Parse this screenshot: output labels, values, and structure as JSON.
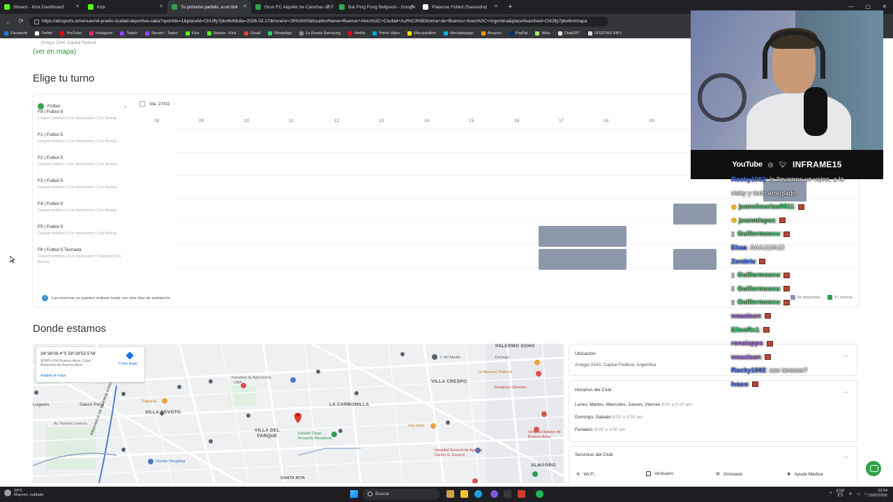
{
  "browser": {
    "tabs": [
      {
        "label": "Stream - Kick Dashboard",
        "color": "#53fc18",
        "glyph": "K"
      },
      {
        "label": "Kick",
        "color": "#53fc18",
        "glyph": "K"
      },
      {
        "label": "Tu próximo partido, a un link",
        "color": "#2fa24b",
        "glyph": "•"
      },
      {
        "label": "Grun FC Alquiler de Canchas de F",
        "color": "#2fa24b",
        "glyph": "•"
      },
      {
        "label": "Bar Ping Pong Belgrano - Google",
        "color": "#34a853",
        "glyph": "•"
      },
      {
        "label": "Platense Fútbol (Saavedra)",
        "color": "#ffffff",
        "glyph": ""
      }
    ],
    "url": "https://atcsports.io/venues/el-predio-ciudad-deportiva-caba?sportIds=1&placeId=ChIJ9y7pkx6v8&dia=2026-02-27&horario=19%3A00&locationName=Buenos+Aires%2C+Ciudad+Aut%C3%B3noma+de+Buenos+Aires%2C+Argentina&placeSearched=ChIJ9y7pkx6v#mapa",
    "bookmarks": [
      {
        "label": "Facebook",
        "color": "#1877f2"
      },
      {
        "label": "Twitter",
        "color": "#ffffff"
      },
      {
        "label": "YouTube",
        "color": "#ff0000"
      },
      {
        "label": "Instagram",
        "color": "#e1306c"
      },
      {
        "label": "Twitch",
        "color": "#9146ff"
      },
      {
        "label": "Stream - Twitch",
        "color": "#9146ff"
      },
      {
        "label": "Kick",
        "color": "#53fc18"
      },
      {
        "label": "Stream - Kick",
        "color": "#53fc18"
      },
      {
        "label": "Gmail",
        "color": "#ea4335"
      },
      {
        "label": "WhatsApp",
        "color": "#25d366"
      },
      {
        "label": "La Ronda Simracing",
        "color": "#888888"
      },
      {
        "label": "Netflix",
        "color": "#e50914"
      },
      {
        "label": "Prime Video",
        "color": "#00a8e1"
      },
      {
        "label": "Mercadolibre",
        "color": "#ffe600"
      },
      {
        "label": "Mercadopago",
        "color": "#00b1ea"
      },
      {
        "label": "Amazon",
        "color": "#ff9900"
      },
      {
        "label": "PayPal",
        "color": "#003087"
      },
      {
        "label": "Wise",
        "color": "#9fe870"
      },
      {
        "label": "ChatGPT",
        "color": "#dddddd"
      },
      {
        "label": "OFERTAS RIKY",
        "color": "#dddddd"
      }
    ]
  },
  "page": {
    "address_line": "Arregui 2540, Capital Federal",
    "ver_mapa": "(ver en mapa)",
    "turno_title": "Elige tu turno",
    "sport": "Fútbol",
    "date": "Vie. 27/02",
    "hours": [
      "08",
      "09",
      "10",
      "11",
      "12",
      "13",
      "14",
      "15",
      "16",
      "17",
      "18",
      "19"
    ],
    "courts": [
      {
        "name": "F8 | Futbol 8",
        "desc": "Césped sintético | Con iluminación | Con Beelup"
      },
      {
        "name": "F1 | Futbol 5",
        "desc": "Césped sintético | Con iluminación | Con Beelup"
      },
      {
        "name": "F2 | Futbol 5",
        "desc": "Césped sintético | Con iluminación | Con Beelup"
      },
      {
        "name": "F3 | Futbol 5",
        "desc": "Césped sintético | Con iluminación | Con Beelup"
      },
      {
        "name": "F4 | Futbol 5",
        "desc": "Césped sintético | Con iluminación | Con Beelup"
      },
      {
        "name": "F5 | Futbol 5",
        "desc": "Césped sintético | Con iluminación | Con Beelup"
      },
      {
        "name": "F6 | Futbol 5 Techada",
        "desc": "Césped sintético | Con iluminación | Cubierta | Con Beelup"
      }
    ],
    "reservas_note": "Las reservas se pueden realizar hasta con seis días de antelación",
    "legend": {
      "no_disponible": "No disponible",
      "tu_reserva": "Tu reserva",
      "no_disp_color": "#8d99aa",
      "tu_reserva_color": "#2fa24b"
    },
    "donde_title": "Donde estamos",
    "map": {
      "coords": "34°36'09.4\"S 58°28'53.5\"W",
      "plus_code": "9GWF+X94 Buenos Aires, Cdad. Autónoma de Buenos Aires",
      "ampliar": "Ampliar el mapa",
      "como_llegar": "Cómo llegar",
      "labels": {
        "palermo_soho": "PALERMO SOHO",
        "villa_crespo": "VILLA CRESPO",
        "la_carbonilla": "LA CARBONILLA",
        "villa_devoto": "VILLA DEVOTO",
        "villa_del_parque": "VILLA DEL PARQUE",
        "saenz_pena": "Sáenz Peña",
        "lugares": "Lugares",
        "agronomia": "Facultad de Agronomía - UBA",
        "rapanui": "Rapanui",
        "devoto_shopping": "Devoto Shopping",
        "estadio": "Estadio Diego Armando Maradona",
        "c_art_media": "C Art Media",
        "la_alacena": "La Alacena Trattoria",
        "sanatorio_guemes": "Sanatorio Güemes",
        "hospital_italiano": "Hospital Italiano de Buenos Aires",
        "hospital_durand": "Hospital General de Agudos Carlos G. Durand",
        "dorrego": "Dorrego",
        "zoo_zoilo": "Zoo Zoilo",
        "almagro": "ALMAGRO",
        "ramon_lorenzo": "Av. Ramón Lorenzo",
        "santa_rita": "SANTA RITA",
        "prov_bsas": "PROVINCIA DE BUENOS AIRES"
      }
    },
    "ubicacion": {
      "title": "Ubicación",
      "value": "Arregui 2540, Capital Federal, Argentina"
    },
    "horarios": {
      "title": "Horarios del Club",
      "rows": [
        {
          "days": "Lunes, Martes, Miercoles, Jueves, Viernes",
          "time": "8:00 a 0:00 am"
        },
        {
          "days": "Domingo, Sabado",
          "time": "8:00 a 0:00 am"
        },
        {
          "days": "Feriados:",
          "time": "8:00 a 0:00 am"
        }
      ]
    },
    "servicios": {
      "title": "Servicios del Club",
      "items": [
        "Wi-Fi",
        "Vestuario",
        "Gimnasio",
        "Ayuda Médica"
      ]
    }
  },
  "stream": {
    "bar": {
      "youtube": "YouTube",
      "handle": "INFRAME15"
    },
    "chat": [
      {
        "user": "Rocky1092",
        "text": ": le llevamos un vaino, a la",
        "ucolor": "#4a76ff"
      },
      {
        "user": "",
        "text": "vieky y todo arreglado",
        "ucolor": "#ffffff"
      },
      {
        "user": "juanchoarias9811",
        "text": ":",
        "ucolor": "#3ad66b"
      },
      {
        "user": "juanmlopez",
        "text": ":",
        "ucolor": "#3ad66b"
      },
      {
        "user": "Guillermoscu",
        "text": ":",
        "ucolor": "#3ad66b"
      },
      {
        "user": "Ekaa",
        "text": ": AAAJJJAJJ",
        "ucolor": "#4a76ff"
      },
      {
        "user": "Zenttrix",
        "text": ":",
        "ucolor": "#4a76ff"
      },
      {
        "user": "Guillermoscu",
        "text": ":",
        "ucolor": "#3ad66b"
      },
      {
        "user": "Guillermoscu",
        "text": ":",
        "ucolor": "#3ad66b"
      },
      {
        "user": "Guillermoscu",
        "text": ":",
        "ucolor": "#3ad66b"
      },
      {
        "user": "waaalaan",
        "text": ":",
        "ucolor": "#a96ee8"
      },
      {
        "user": "EllenRx1",
        "text": ":",
        "ucolor": "#3ad66b"
      },
      {
        "user": "ronaiapps",
        "text": ":",
        "ucolor": "#a96ee8"
      },
      {
        "user": "waaalaan",
        "text": ":",
        "ucolor": "#a96ee8"
      },
      {
        "user": "Rocky1092",
        "text": ": con teresos?",
        "ucolor": "#4a76ff"
      },
      {
        "user": "Ivaco",
        "text": ":",
        "ucolor": "#4a76ff"
      }
    ]
  },
  "taskbar": {
    "temp": "24°C",
    "weather": "Mayorm. nublado",
    "search": "Buscar",
    "lang": "ESP",
    "lang2": "ES",
    "time": "22:04",
    "date": "22/02/2026"
  }
}
